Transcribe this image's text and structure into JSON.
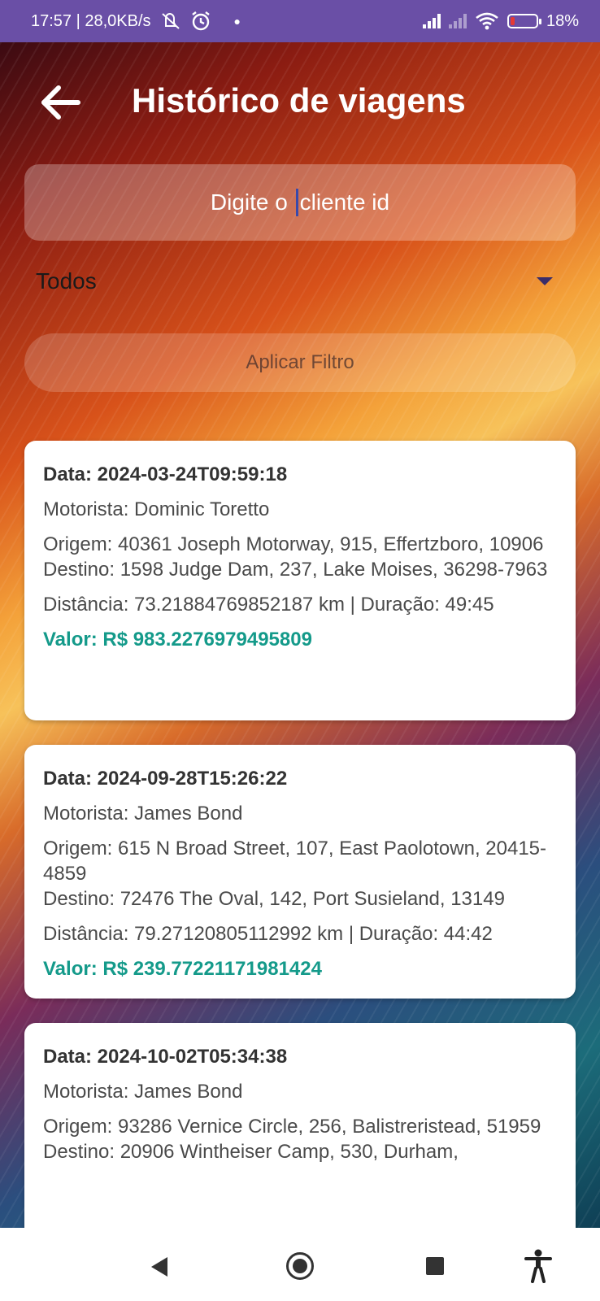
{
  "status_bar": {
    "time_speed": "17:57 | 28,0KB/s",
    "battery": "18%",
    "battery_level": 0.18,
    "icons": [
      "mute-icon",
      "alarm-icon",
      "signal-icon",
      "signal-off-icon",
      "wifi-icon",
      "battery-icon"
    ]
  },
  "header": {
    "title": "Histórico de viagens",
    "back_icon": "arrow-left-icon"
  },
  "search": {
    "placeholder_before": "Digite o ",
    "placeholder_after": "cliente id"
  },
  "filter": {
    "selected": "Todos",
    "apply_label": "Aplicar Filtro"
  },
  "trips": [
    {
      "date": "Data: 2024-03-24T09:59:18",
      "driver": "Motorista: Dominic Toretto",
      "origin": "Origem: 40361 Joseph Motorway, 915, Effertzboro, 10906",
      "destination": "Destino: 1598 Judge Dam, 237, Lake Moises, 36298-7963",
      "distance": "Distância: 73.21884769852187 km | Duração: 49:45",
      "value": "Valor: R$ 983.2276979495809"
    },
    {
      "date": "Data: 2024-09-28T15:26:22",
      "driver": "Motorista: James Bond",
      "origin": "Origem: 615 N Broad Street, 107, East Paolotown, 20415-4859",
      "destination": "Destino: 72476 The Oval, 142, Port Susieland, 13149",
      "distance": "Distância: 79.27120805112992 km | Duração: 44:42",
      "value": "Valor: R$ 239.77221171981424"
    },
    {
      "date": "Data: 2024-10-02T05:34:38",
      "driver": "Motorista: James Bond",
      "origin": "Origem: 93286 Vernice Circle, 256, Balistreristead, 51959",
      "destination": "Destino: 20906 Wintheiser Camp, 530, Durham,"
    }
  ],
  "nav_bar": {
    "icons": [
      "back-triangle-icon",
      "home-circle-icon",
      "recents-square-icon",
      "accessibility-icon"
    ]
  }
}
